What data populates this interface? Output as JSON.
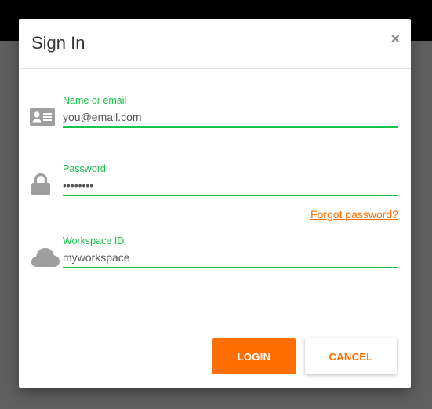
{
  "dialog": {
    "title": "Sign In",
    "close_label": "×"
  },
  "fields": {
    "name": {
      "label": "Name or email",
      "value": "you@email.com",
      "icon": "id-card-icon"
    },
    "password": {
      "label": "Password",
      "value": "••••••••",
      "icon": "lock-icon"
    },
    "workspace": {
      "label": "Workspace ID",
      "value": "myworkspace",
      "icon": "cloud-icon"
    }
  },
  "links": {
    "forgot_password": "Forgot password?"
  },
  "buttons": {
    "login": "LOGIN",
    "cancel": "CANCEL"
  },
  "colors": {
    "accent": "#ff6e00",
    "field_active": "#19c24a",
    "icon": "#9e9e9e",
    "overlay": "#5f5f5f"
  }
}
